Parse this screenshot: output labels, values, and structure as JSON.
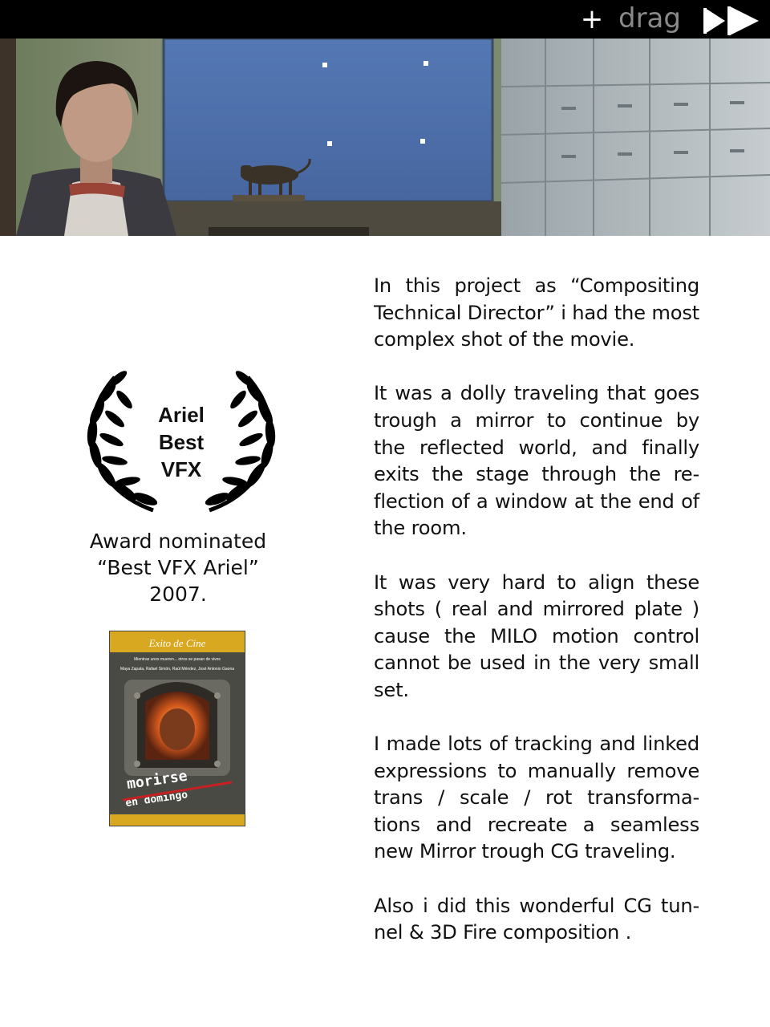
{
  "toolbar": {
    "add_label": "+",
    "drag_label": "drag",
    "forward_icon": "fast-forward-icon"
  },
  "hero": {
    "description_icon": "film-still-image"
  },
  "award": {
    "laurel_lines": [
      "Ariel",
      "Best",
      "VFX"
    ],
    "caption_lines": [
      "Award nominated",
      "“Best VFX Ariel”",
      "2007."
    ]
  },
  "poster": {
    "banner": "Exito de Cine",
    "credits_1": "Mientras unos mueren... otros se pasan de vivos",
    "credits_2": "Maya Zapata, Rafael Simón, Raúl Méndez, José Antonio Gaona",
    "title_1": "morirse",
    "title_2": "en domingo"
  },
  "body": {
    "paragraphs": [
      "In this project as “Compositing Technical Director”  i had the most complex shot of the movie.",
      "It was a dolly traveling that goes trough a mirror  to continue by the reflected world, and  finally exits the stage through the re-flection of a window at the end of the room.",
      "It was very hard to align these shots ( real and mirrored plate ) cause the MILO motion control cannot be used in the very small set.",
      "I made lots of tracking and linked expressions to manually remove trans / scale / rot transforma-tions and recreate a seamless new Mirror trough CG traveling.",
      "Also i did this wonderful CG tun-nel & 3D Fire composition ."
    ]
  },
  "colors": {
    "topbar": "#000000",
    "drag_text": "#8a8a8a",
    "bluescreen": "#4f6ea8",
    "text": "#111111",
    "poster_banner": "#d8a820"
  }
}
